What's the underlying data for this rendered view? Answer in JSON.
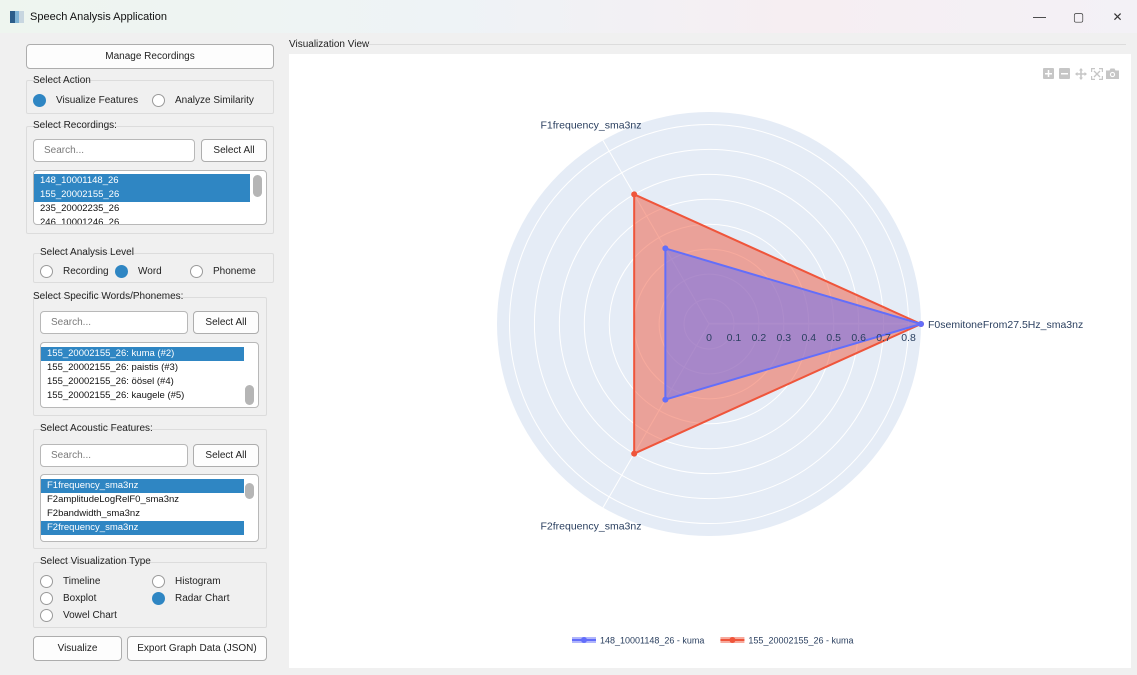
{
  "window": {
    "title": "Speech Analysis Application",
    "controls": [
      "—",
      "▢",
      "✕"
    ]
  },
  "left_panel": {
    "manage_button": "Manage Recordings",
    "action": {
      "label": "Select Action",
      "options": [
        "Visualize Features",
        "Analyze Similarity"
      ],
      "selected": "Visualize Features"
    },
    "recordings": {
      "label": "Select Recordings:",
      "search_placeholder": "Search...",
      "select_all": "Select All",
      "items": [
        {
          "text": "148_10001148_26",
          "selected": true
        },
        {
          "text": "155_20002155_26",
          "selected": true
        },
        {
          "text": "235_20002235_26",
          "selected": false
        },
        {
          "text": "246_10001246_26",
          "selected": false
        }
      ]
    },
    "analysis_level": {
      "label": "Select Analysis Level",
      "options": [
        "Recording",
        "Word",
        "Phoneme"
      ],
      "selected": "Word"
    },
    "words": {
      "label": "Select Specific Words/Phonemes:",
      "search_placeholder": "Search...",
      "select_all": "Select All",
      "items": [
        {
          "text": "155_20002155_26: kuma (#2)",
          "selected": true
        },
        {
          "text": "155_20002155_26: paistis (#3)",
          "selected": false
        },
        {
          "text": "155_20002155_26: öösel (#4)",
          "selected": false
        },
        {
          "text": "155_20002155_26: kaugele (#5)",
          "selected": false
        }
      ]
    },
    "features": {
      "label": "Select Acoustic Features:",
      "search_placeholder": "Search...",
      "select_all": "Select All",
      "items": [
        {
          "text": "F1frequency_sma3nz",
          "selected": true
        },
        {
          "text": "F2amplitudeLogRelF0_sma3nz",
          "selected": false
        },
        {
          "text": "F2bandwidth_sma3nz",
          "selected": false
        },
        {
          "text": "F2frequency_sma3nz",
          "selected": true
        }
      ]
    },
    "viz_type": {
      "label": "Select Visualization Type",
      "options": [
        "Timeline",
        "Histogram",
        "Boxplot",
        "Radar Chart",
        "Vowel Chart"
      ],
      "selected": "Radar Chart"
    },
    "visualize_button": "Visualize",
    "export_button": "Export Graph Data (JSON)"
  },
  "visualization": {
    "label": "Visualization View",
    "modebar_icons": [
      "zoom-in-icon",
      "zoom-out-icon",
      "pan-icon",
      "autoscale-icon",
      "camera-icon"
    ]
  },
  "chart_data": {
    "type": "radar",
    "axes": [
      "F0semitoneFrom27.5Hz_sma3nz",
      "F1frequency_sma3nz",
      "F2frequency_sma3nz"
    ],
    "radial_ticks": [
      "0",
      "0.1",
      "0.2",
      "0.3",
      "0.4",
      "0.5",
      "0.6",
      "0.7",
      "0.8"
    ],
    "radial_range": [
      0,
      0.85
    ],
    "series": [
      {
        "name": "148_10001148_26 - kuma",
        "values": [
          0.85,
          0.35,
          0.35
        ],
        "color": "#636efa"
      },
      {
        "name": "155_20002155_26 - kuma",
        "values": [
          0.85,
          0.6,
          0.6
        ],
        "color": "#ef553b"
      }
    ],
    "legend_placement": "bottom-center",
    "grid": true
  }
}
